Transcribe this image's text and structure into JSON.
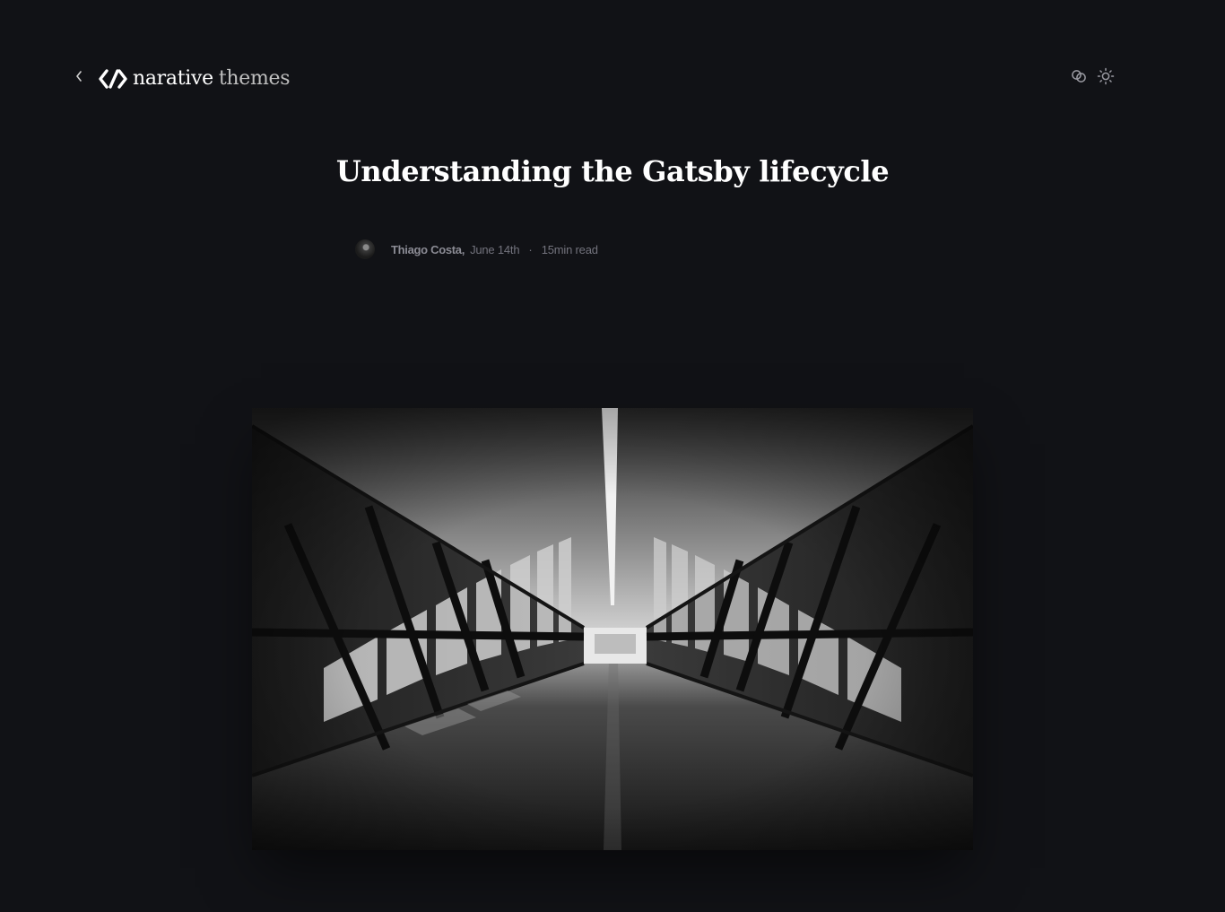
{
  "header": {
    "back_icon": "chevron-left-icon",
    "logo": {
      "word_primary": "narative",
      "word_secondary": "themes",
      "icon": "narative-logo-mark"
    },
    "actions": [
      {
        "name": "copy-link",
        "icon": "link-icon"
      },
      {
        "name": "toggle-theme",
        "icon": "sun-icon"
      }
    ]
  },
  "article": {
    "title": "Understanding the Gatsby lifecycle",
    "author": "Thiago Costa,",
    "date": "June 14th",
    "separator": "·",
    "read_time": "15min read",
    "hero_image": "black-and-white-corridor-photo"
  },
  "colors": {
    "background": "#111216",
    "title": "#ffffff",
    "meta": "#73737d",
    "author": "#8b8b94",
    "logo_secondary": "#bfbfbf"
  }
}
